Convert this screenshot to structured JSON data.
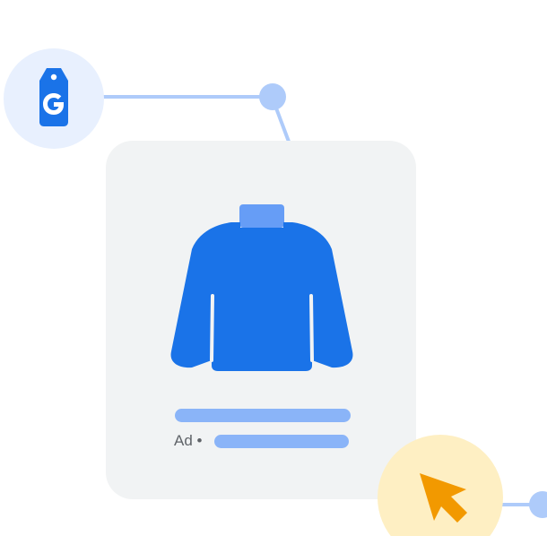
{
  "ad_card": {
    "ad_label": "Ad •",
    "title_line_color": "#8ab4f8",
    "card_color": "#f1f3f4"
  },
  "colors": {
    "primary_blue": "#1a73e8",
    "light_blue": "#d2e3fc",
    "connector_blue": "#aecbfa",
    "collar_blue": "#669df6",
    "cursor_orange": "#f29900",
    "cursor_bg": "#feefc3"
  },
  "icons": {
    "tag": "google-shopping-tag-icon",
    "product": "sweater-icon",
    "cursor": "cursor-arrow-icon"
  }
}
